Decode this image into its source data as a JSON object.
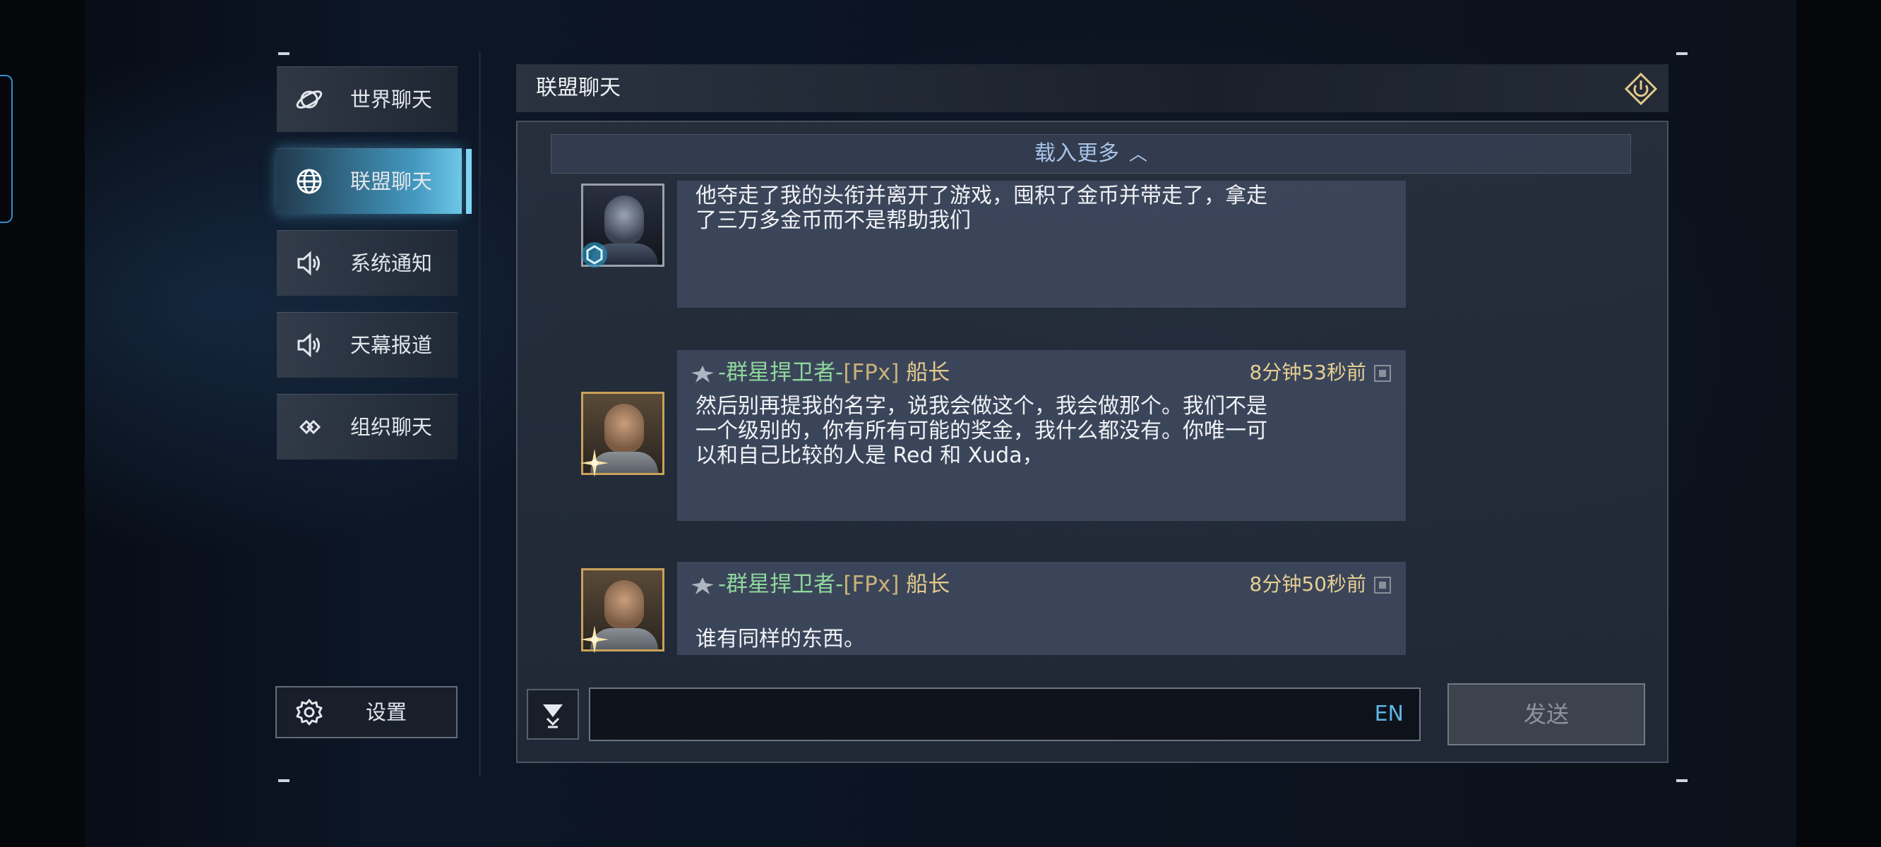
{
  "sidebar": {
    "items": [
      {
        "label": "世界聊天",
        "icon": "planet-icon",
        "active": false
      },
      {
        "label": "联盟聊天",
        "icon": "globe-icon",
        "active": true
      },
      {
        "label": "系统通知",
        "icon": "speaker-icon",
        "active": false
      },
      {
        "label": "天幕报道",
        "icon": "speaker-icon",
        "active": false
      },
      {
        "label": "组织聊天",
        "icon": "link-icon",
        "active": false
      }
    ],
    "settings_label": "设置"
  },
  "header": {
    "title": "联盟聊天",
    "power_icon": "power-icon"
  },
  "chat": {
    "load_more": "载入更多",
    "messages": [
      {
        "text": "他夺走了我的头衔并离开了游戏，囤积了金币并带走了，拿走\n了三万多金币而不是帮助我们"
      },
      {
        "guild": "-群星捍卫者-",
        "tag": "[FPx]",
        "role": "船长",
        "time": "8分钟53秒前",
        "text": "然后别再提我的名字，说我会做这个，我会做那个。我们不是\n一个级别的，你有所有可能的奖金，我什么都没有。你唯一可\n以和自己比较的人是 Red 和 Xuda，"
      },
      {
        "guild": "-群星捍卫者-",
        "tag": "[FPx]",
        "role": "船长",
        "time": "8分钟50秒前",
        "text": "谁有同样的东西。"
      }
    ]
  },
  "composer": {
    "value": "",
    "lang": "EN",
    "send_label": "发送"
  },
  "colors": {
    "accent": "#7fd6f4",
    "guild_name": "#8fd79c",
    "role": "#e3c98a",
    "time": "#e6cf92",
    "link": "#a9c3e8"
  }
}
